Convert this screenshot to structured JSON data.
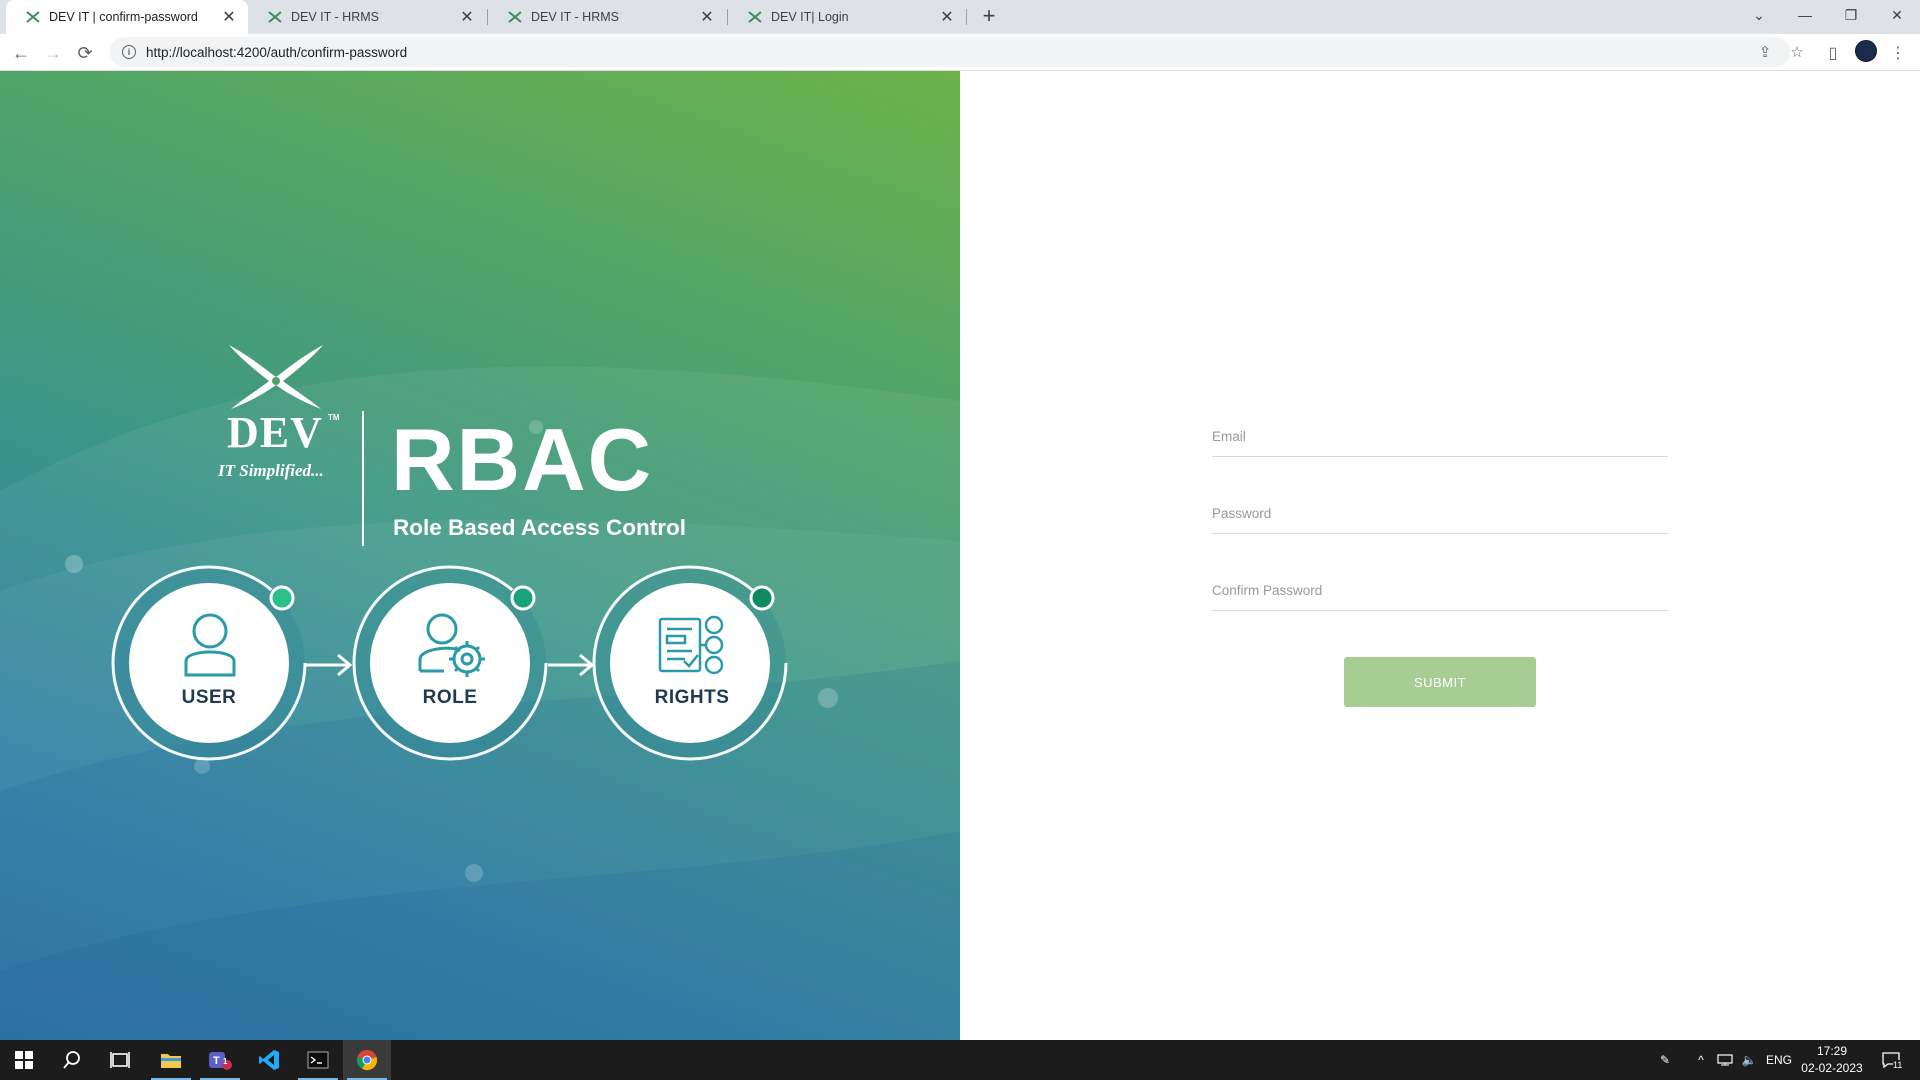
{
  "browser": {
    "tabs": [
      {
        "title": "DEV IT | confirm-password",
        "active": true
      },
      {
        "title": "DEV IT - HRMS",
        "active": false
      },
      {
        "title": "DEV IT - HRMS",
        "active": false
      },
      {
        "title": "DEV IT| Login",
        "active": false
      }
    ],
    "new_tab": "+",
    "url": "http://localhost:4200/auth/confirm-password"
  },
  "hero": {
    "brand_name": "DEV",
    "brand_trademark": "TM",
    "brand_tagline": "IT Simplified...",
    "product_name": "RBAC",
    "product_subtitle": "Role Based Access Control",
    "nodes": [
      {
        "label": "USER",
        "icon": "user-icon"
      },
      {
        "label": "ROLE",
        "icon": "role-gear-icon"
      },
      {
        "label": "RIGHTS",
        "icon": "rights-document-icon"
      }
    ],
    "colors": {
      "gradient_top": "#6db34a",
      "gradient_bottom": "#1d6aa0",
      "node_dot": "#2bbf8a"
    }
  },
  "form": {
    "email_placeholder": "Email",
    "password_placeholder": "Password",
    "confirm_password_placeholder": "Confirm Password",
    "submit_label": "SUBMIT",
    "submit_color": "#a7cc94"
  },
  "taskbar": {
    "language": "ENG",
    "time": "17:29",
    "date": "02-02-2023",
    "notification_count": "11",
    "teams_badge": "1"
  }
}
